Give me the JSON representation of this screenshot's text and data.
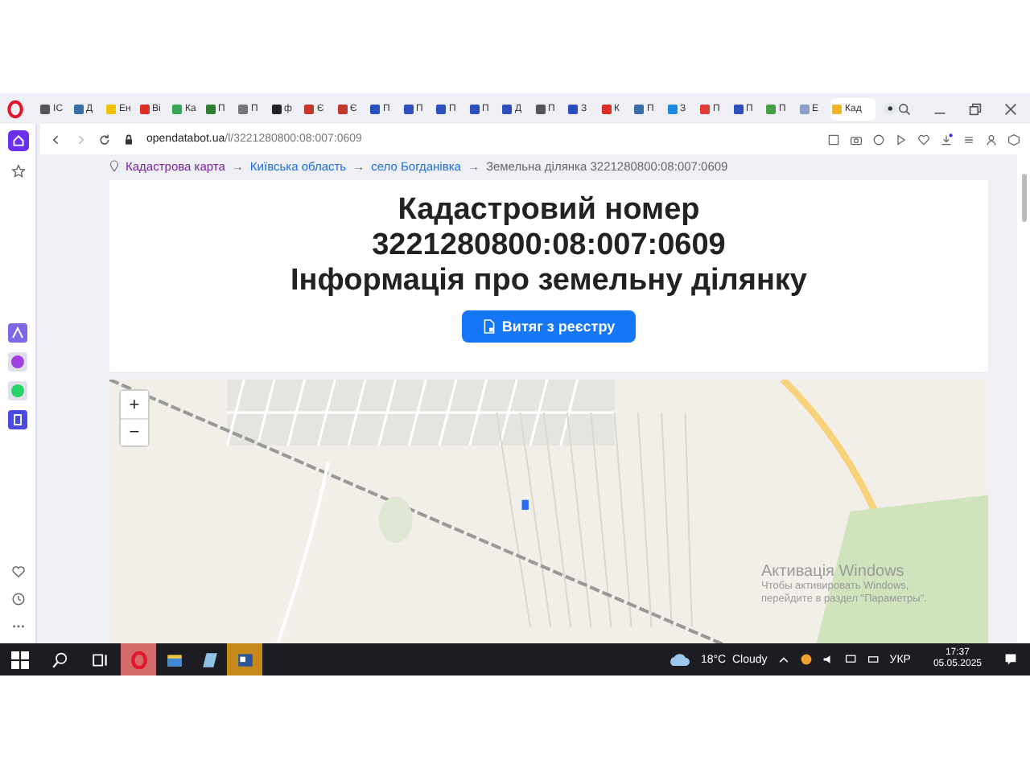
{
  "tabs": [
    {
      "label": "ІС",
      "selected": false,
      "color": "#555555"
    },
    {
      "label": "Д",
      "selected": false,
      "color": "#3a6ea5"
    },
    {
      "label": "Ен",
      "selected": false,
      "color": "#f2c200"
    },
    {
      "label": "Ві",
      "selected": false,
      "color": "#d93025"
    },
    {
      "label": "Ка",
      "selected": false,
      "color": "#34a853"
    },
    {
      "label": "П",
      "selected": false,
      "color": "#2e7d32"
    },
    {
      "label": "П",
      "selected": false,
      "color": "#777777"
    },
    {
      "label": "ф",
      "selected": false,
      "color": "#222222"
    },
    {
      "label": "Є",
      "selected": false,
      "color": "#c0392b"
    },
    {
      "label": "Є",
      "selected": false,
      "color": "#c0392b"
    },
    {
      "label": "П",
      "selected": false,
      "color": "#2b4fbf"
    },
    {
      "label": "П",
      "selected": false,
      "color": "#2b4fbf"
    },
    {
      "label": "П",
      "selected": false,
      "color": "#2b4fbf"
    },
    {
      "label": "П",
      "selected": false,
      "color": "#2b4fbf"
    },
    {
      "label": "Д",
      "selected": false,
      "color": "#2b4fbf"
    },
    {
      "label": "П",
      "selected": false,
      "color": "#555555"
    },
    {
      "label": "З",
      "selected": false,
      "color": "#2b4fbf"
    },
    {
      "label": "К",
      "selected": false,
      "color": "#d93025"
    },
    {
      "label": "П",
      "selected": false,
      "color": "#3a6ea5"
    },
    {
      "label": "З",
      "selected": false,
      "color": "#1e88e5"
    },
    {
      "label": "П",
      "selected": false,
      "color": "#e53935"
    },
    {
      "label": "П",
      "selected": false,
      "color": "#2b4fbf"
    },
    {
      "label": "П",
      "selected": false,
      "color": "#43a047"
    },
    {
      "label": "Е",
      "selected": false,
      "color": "#8aa0c8"
    },
    {
      "label": "Кад",
      "selected": true,
      "color": "#f0b429"
    }
  ],
  "address": {
    "host": "opendatabot.ua",
    "path": "/l/3221280800:08:007:0609"
  },
  "breadcrumb_separator": "→",
  "breadcrumbs": [
    {
      "label": "Кадастрова карта",
      "kind": "visited"
    },
    {
      "label": "Київська область",
      "kind": "link"
    },
    {
      "label": "село Богданівка",
      "kind": "link"
    },
    {
      "label": "Земельна ділянка 3221280800:08:007:0609",
      "kind": "current"
    }
  ],
  "title_lines": [
    "Кадастровий номер",
    "3221280800:08:007:0609",
    "Інформація про земельну ділянку"
  ],
  "extract_button": "Витяг з реєстру",
  "map": {
    "zoom_in": "+",
    "zoom_out": "−"
  },
  "activation": {
    "title": "Активація Windows",
    "text": "Чтобы активировать Windows, перейдите в раздел \"Параметры\"."
  },
  "taskbar": {
    "weather": "18°C  Cloudy",
    "language": "УКР",
    "time": "17:37",
    "date": "05.05.2025"
  }
}
